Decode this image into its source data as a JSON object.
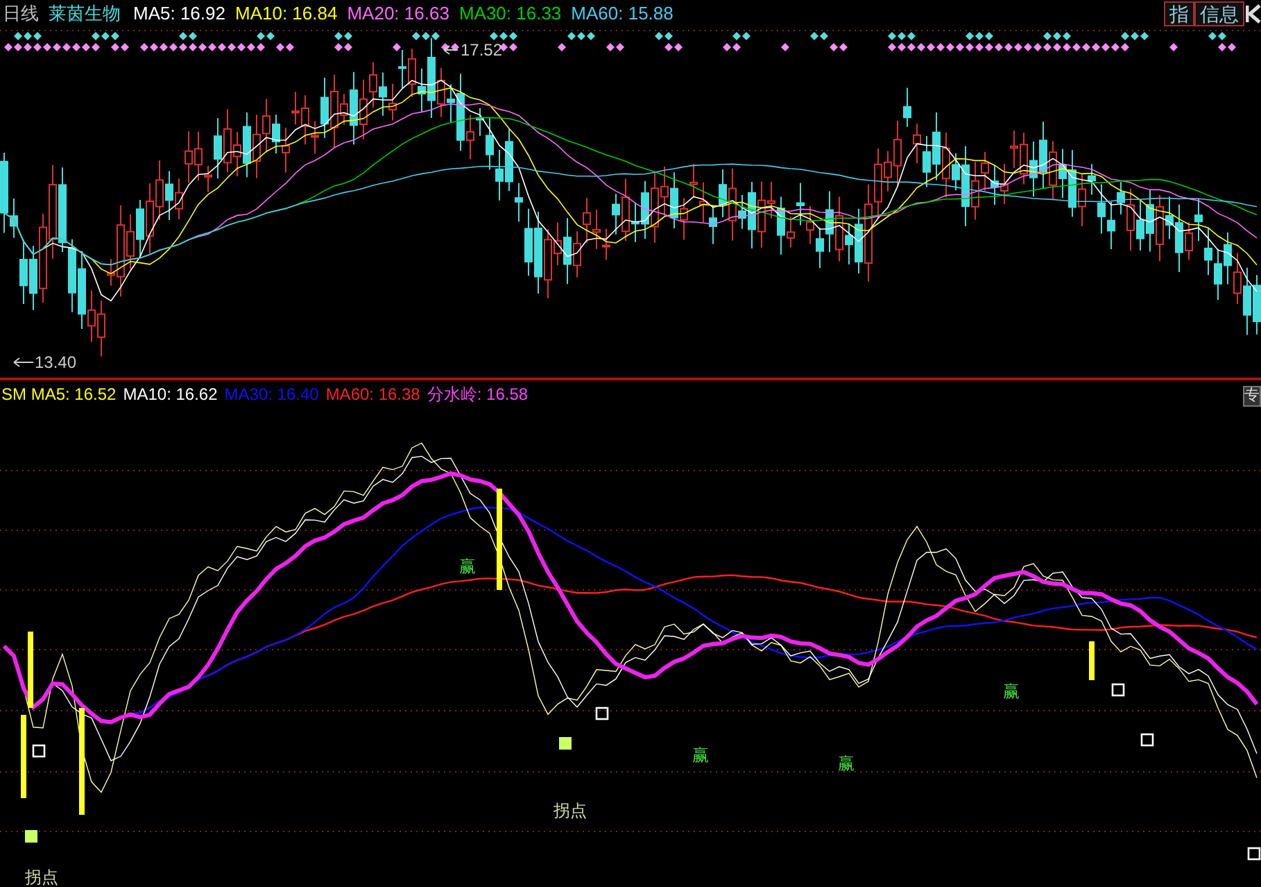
{
  "top_header": {
    "period": "日线",
    "stock_name": "莱茵生物",
    "indicators": [
      {
        "label": "MA5: 16.92",
        "color": "#ffffff"
      },
      {
        "label": "MA10: 16.84",
        "color": "#ffff00"
      },
      {
        "label": "MA20: 16.63",
        "color": "#ff66ff"
      },
      {
        "label": "MA30: 16.33",
        "color": "#00cc00"
      },
      {
        "label": "MA60: 15.88",
        "color": "#44ccee"
      }
    ]
  },
  "toolbar_buttons": [
    {
      "label": "指"
    },
    {
      "label": "信息"
    }
  ],
  "price_chart": {
    "high_label": "17.52",
    "low_label": "13.40"
  },
  "indicator_header": {
    "items": [
      {
        "label": "SM MA5: 16.52",
        "color": "#ffff00"
      },
      {
        "label": "MA10: 16.62",
        "color": "#ffffff"
      },
      {
        "label": "MA30: 16.40",
        "color": "#1010ff"
      },
      {
        "label": "MA60: 16.38",
        "color": "#ff2020"
      },
      {
        "label": "分水岭: 16.58",
        "color": "#ff40ff"
      }
    ],
    "side_button": "专"
  },
  "indicator_chart": {
    "signals": [
      {
        "kind": "win",
        "text": "赢"
      },
      {
        "kind": "win",
        "text": "赢"
      },
      {
        "kind": "win",
        "text": "赢"
      },
      {
        "kind": "win",
        "text": "赢"
      },
      {
        "kind": "turn",
        "text": "拐点"
      },
      {
        "kind": "turn",
        "text": "拐点"
      }
    ]
  }
}
